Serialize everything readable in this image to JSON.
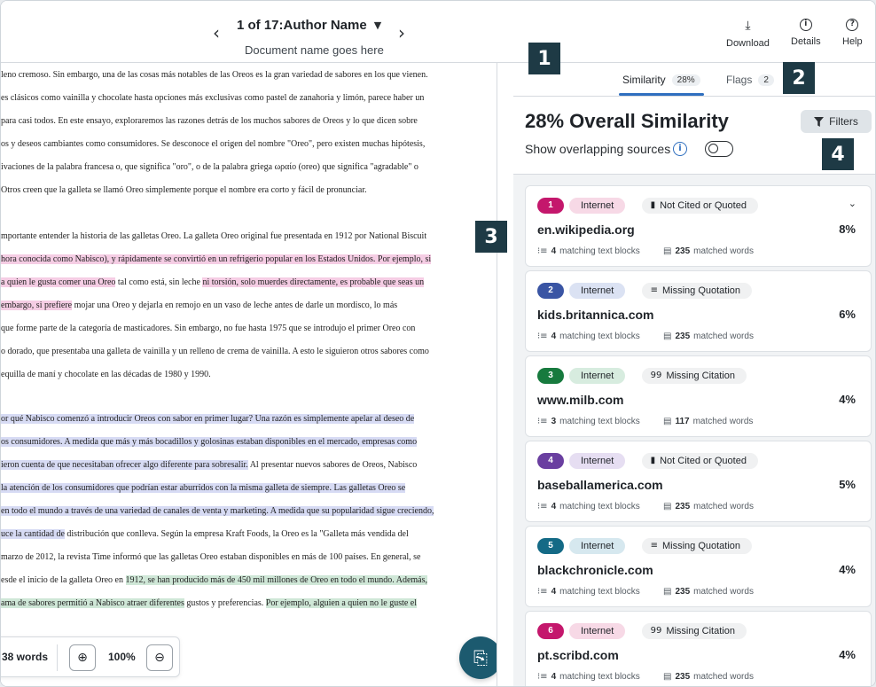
{
  "topbar": {
    "doc_title": "1 of 17:Author Name",
    "doc_subtitle": "Document name goes here",
    "download_label": "Download",
    "details_label": "Details",
    "help_label": "Help"
  },
  "document": {
    "lines": [
      {
        "segments": [
          {
            "t": "leno cremoso. Sin embargo, una de las cosas más notables de las Oreos es la gran variedad de sabores en los que vienen.",
            "h": ""
          }
        ]
      },
      {
        "segments": [
          {
            "t": "es clásicos como vainilla y chocolate hasta opciones más exclusivas como pastel de zanahoria y limón, parece haber un",
            "h": ""
          }
        ]
      },
      {
        "segments": [
          {
            "t": "para casi todos. En este ensayo, exploraremos las razones detrás de los muchos sabores de Oreos y lo que dicen sobre",
            "h": ""
          }
        ]
      },
      {
        "segments": [
          {
            "t": "os y deseos cambiantes como consumidores. Se desconoce el origen del nombre \"Oreo\", pero existen muchas hipótesis,",
            "h": ""
          }
        ]
      },
      {
        "segments": [
          {
            "t": "ivaciones de la palabra francesa o, que significa \"oro\", o de la palabra griega ωραίο (oreo) que significa \"agradable\" o",
            "h": ""
          }
        ]
      },
      {
        "segments": [
          {
            "t": "Otros creen que la galleta se llamó Oreo simplemente porque el nombre era corto y fácil de pronunciar.",
            "h": ""
          }
        ]
      },
      {
        "segments": [
          {
            "t": "mportante entender la historia de las galletas Oreo. La galleta Oreo original fue presentada en 1912 por National Biscuit",
            "h": ""
          }
        ]
      },
      {
        "segments": [
          {
            "t": "hora conocida como Nabisco), y rápidamente se convirtió en un refrigerio popular en los Estados Unidos. Por ejemplo, si",
            "h": "pink"
          }
        ]
      },
      {
        "segments": [
          {
            "t": "a quien le gusta comer una Oreo",
            "h": "pink"
          },
          {
            "t": " tal como está, sin leche ",
            "h": ""
          },
          {
            "t": "ni torsión, solo muerdes directamente, es probable que seas un",
            "h": "pink"
          }
        ]
      },
      {
        "segments": [
          {
            "t": " embargo, si prefiere",
            "h": "pink"
          },
          {
            "t": " mojar una Oreo y dejarla en remojo en un vaso de leche antes de darle un mordisco, lo más",
            "h": ""
          }
        ]
      },
      {
        "segments": [
          {
            "t": "que forme parte de la categoría de masticadores. Sin embargo, no fue hasta 1975 que se introdujo el primer Oreo con",
            "h": ""
          }
        ]
      },
      {
        "segments": [
          {
            "t": "o dorado, que presentaba una galleta de vainilla y un relleno de crema de vainilla. A esto le siguieron otros sabores como",
            "h": ""
          }
        ]
      },
      {
        "segments": [
          {
            "t": "equilla de maní y chocolate en las décadas de 1980 y 1990.",
            "h": ""
          }
        ]
      },
      {
        "segments": [
          {
            "t": "or qué Nabisco comenzó a introducir Oreos con sabor en primer lugar? Una razón es simplemente apelar al deseo de",
            "h": "blue"
          }
        ]
      },
      {
        "segments": [
          {
            "t": "os consumidores. A medida que más y más bocadillos y golosinas estaban disponibles en el mercado, empresas como",
            "h": "blue"
          }
        ]
      },
      {
        "segments": [
          {
            "t": "ieron cuenta de que necesitaban ofrecer algo diferente para sobresalir.",
            "h": "blue"
          },
          {
            "t": " Al presentar nuevos sabores de Oreos, Nabisco",
            "h": ""
          }
        ]
      },
      {
        "segments": [
          {
            "t": " la atención de los consumidores que podrían estar aburridos con la misma galleta de siempre. Las galletas Oreo se",
            "h": "blue"
          }
        ]
      },
      {
        "segments": [
          {
            "t": "en todo el mundo a través de una variedad de canales de venta y marketing. A medida que su popularidad sigue creciendo,",
            "h": "blue"
          }
        ]
      },
      {
        "segments": [
          {
            "t": "uce la cantidad de",
            "h": "blue"
          },
          {
            "t": " distribución que conlleva. Según la empresa Kraft Foods, la Oreo es la \"Galleta más vendida del",
            "h": ""
          }
        ]
      },
      {
        "segments": [
          {
            "t": "marzo de 2012, la revista Time informó que las galletas Oreo estaban disponibles en más de 100 países. En general, se",
            "h": ""
          }
        ]
      },
      {
        "segments": [
          {
            "t": "esde el inicio de la galleta Oreo en ",
            "h": ""
          },
          {
            "t": "1912, se han producido más de 450 mil millones de Oreo en todo el mundo. Además,",
            "h": "green"
          }
        ]
      },
      {
        "segments": [
          {
            "t": "ama de sabores permitió a Nabisco atraer diferentes",
            "h": "green"
          },
          {
            "t": " gustos y preferencias. ",
            "h": ""
          },
          {
            "t": "Por ejemplo, alguien a quien no le guste el",
            "h": "green"
          }
        ]
      }
    ],
    "word_count": "38 words",
    "zoom_level": "100%"
  },
  "panel": {
    "tabs": [
      {
        "label": "Similarity",
        "count": "28%"
      },
      {
        "label": "Flags",
        "count": "2"
      }
    ],
    "title": "28% Overall Similarity",
    "overlap_label": "Show overlapping sources",
    "overlap_on": false,
    "filters_label": "Filters",
    "sources": [
      {
        "num": "1",
        "color": "#c4176c",
        "pill_bg": "#f7d9e6",
        "type": "Internet",
        "status_icon": "▮",
        "status": "Not Cited or Quoted",
        "domain": "en.wikipedia.org",
        "pct": "8%",
        "blocks_n": "4",
        "blocks_label": "matching text blocks",
        "words_n": "235",
        "words_label": "matched words",
        "expandable": true
      },
      {
        "num": "2",
        "color": "#3a55a4",
        "pill_bg": "#dbe2f3",
        "type": "Internet",
        "status_icon": "≡",
        "status": "Missing Quotation",
        "domain": "kids.britannica.com",
        "pct": "6%",
        "blocks_n": "4",
        "blocks_label": "matching text blocks",
        "words_n": "235",
        "words_label": "matched words",
        "expandable": false
      },
      {
        "num": "3",
        "color": "#177a3e",
        "pill_bg": "#d7ecdf",
        "type": "Internet",
        "status_icon": "99",
        "status": "Missing Citation",
        "domain": "www.milb.com",
        "pct": "4%",
        "blocks_n": "3",
        "blocks_label": "matching text blocks",
        "words_n": "117",
        "words_label": "matched words",
        "expandable": false
      },
      {
        "num": "4",
        "color": "#6a3fa0",
        "pill_bg": "#e6def2",
        "type": "Internet",
        "status_icon": "▮",
        "status": "Not Cited or Quoted",
        "domain": "baseballamerica.com",
        "pct": "5%",
        "blocks_n": "4",
        "blocks_label": "matching text blocks",
        "words_n": "235",
        "words_label": "matched words",
        "expandable": false
      },
      {
        "num": "5",
        "color": "#146a86",
        "pill_bg": "#d6e8ef",
        "type": "Internet",
        "status_icon": "≡",
        "status": "Missing Quotation",
        "domain": "blackchronicle.com",
        "pct": "4%",
        "blocks_n": "4",
        "blocks_label": "matching text blocks",
        "words_n": "235",
        "words_label": "matched words",
        "expandable": false
      },
      {
        "num": "6",
        "color": "#c4176c",
        "pill_bg": "#f7d9e6",
        "type": "Internet",
        "status_icon": "99",
        "status": "Missing Citation",
        "domain": "pt.scribd.com",
        "pct": "4%",
        "blocks_n": "4",
        "blocks_label": "matching text blocks",
        "words_n": "235",
        "words_label": "matched words",
        "expandable": false
      }
    ]
  },
  "callouts": [
    "1",
    "2",
    "3",
    "4"
  ],
  "icons": {
    "prev": "chevron-left-icon",
    "next": "chevron-right-icon",
    "download": "download-icon",
    "details": "info-icon",
    "help": "help-icon",
    "filter": "filter-icon",
    "zoom_in": "zoom-in-icon",
    "zoom_out": "zoom-out-icon",
    "fab": "integrity-icon"
  }
}
